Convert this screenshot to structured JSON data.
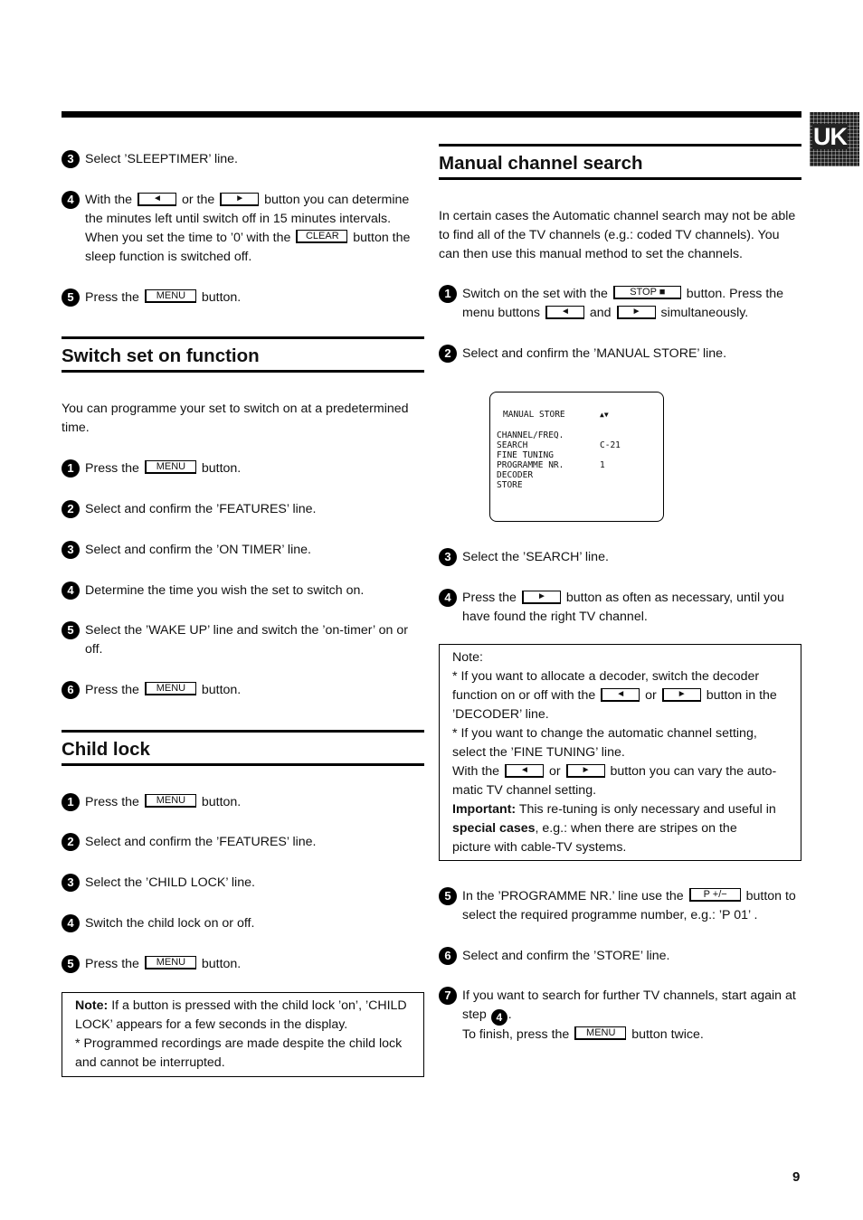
{
  "lang_tab": "UK",
  "page_number": "9",
  "left": {
    "sleep_steps": [
      {
        "num": "3",
        "text": "Select ’SLEEPTIMER’ line."
      },
      {
        "num": "4",
        "parts": [
          "With the",
          "or the",
          "button you can determine the minutes left until switch off in 15 minutes intervals. When you set the time to ’0’ with the",
          "button the sleep function is switched off."
        ]
      },
      {
        "num": "5",
        "parts": [
          "Press the",
          "button."
        ]
      }
    ],
    "switch_on": {
      "title": "Switch set on function",
      "intro": "You can programme your set to switch on at a predetermined time.",
      "steps": [
        {
          "num": "1",
          "parts": [
            "Press the",
            "button."
          ]
        },
        {
          "num": "2",
          "text": "Select and confirm the ’FEATURES’ line."
        },
        {
          "num": "3",
          "text": "Select and confirm the ’ON TIMER’ line."
        },
        {
          "num": "4",
          "text": "Determine the time you wish the set to switch on."
        },
        {
          "num": "5",
          "text": "Select the ’WAKE UP’ line and switch the ’on-timer’ on or off."
        },
        {
          "num": "6",
          "parts": [
            "Press the",
            "button."
          ]
        }
      ]
    },
    "child_lock": {
      "title": "Child lock",
      "steps": [
        {
          "num": "1",
          "parts": [
            "Press the",
            "button."
          ]
        },
        {
          "num": "2",
          "text": "Select and confirm the ’FEATURES’ line."
        },
        {
          "num": "3",
          "text": "Select the ’CHILD LOCK’ line."
        },
        {
          "num": "4",
          "text": "Switch the child lock on or off."
        },
        {
          "num": "5",
          "parts": [
            "Press the",
            "button."
          ]
        }
      ],
      "note_label": "Note:",
      "note_text": " If a button is pressed with the child lock ’on’, ’CHILD LOCK’ appears for a few seconds in the display.",
      "note_text2": "* Programmed recordings are made despite the child lock and cannot be interrupted."
    }
  },
  "right": {
    "manual": {
      "title": "Manual channel search",
      "intro": "In certain cases the Automatic channel search may not be able to find all of the TV channels (e.g.: coded TV channels). You can then use this manual method to set the channels.",
      "step1_parts": [
        "Switch on the set with the",
        "button. Press the menu buttons",
        "and",
        "simultaneously."
      ],
      "step2": "Select and confirm the ’MANUAL STORE’ line.",
      "osd": {
        "title": "MANUAL STORE",
        "arrows": "▲▼",
        "rows": [
          "CHANNEL/FREQ.",
          "SEARCH",
          "FINE TUNING",
          "PROGRAMME NR.",
          "DECODER",
          "STORE"
        ],
        "search_value": "C-21",
        "programme_value": "1"
      },
      "step3": "Select the ’SEARCH’ line.",
      "step4_parts": [
        "Press the",
        "button as often as necessary, until you have found the right TV channel."
      ],
      "note": {
        "label": "Note:",
        "l1": "* If you want to allocate a decoder, switch the decoder",
        "l2a": "function on or off with the",
        "l2b": "or",
        "l2c": "button in the",
        "l3": "’DECODER’ line.",
        "l4": "* If you want to change the automatic channel setting,",
        "l5": "select the ’FINE TUNING’ line.",
        "l6a": "With the",
        "l6b": "or",
        "l6c": "button you can vary the auto-",
        "l7": "matic TV channel setting.",
        "important_label": "Important:",
        "l8": " This re-tuning is only necessary and useful in",
        "special_label": "special cases",
        "l9": ", e.g.: when there are stripes on the",
        "l10": "picture with cable-TV systems."
      },
      "step5_parts": [
        "In the ’PROGRAMME NR.’ line use the",
        "button to select the required programme number, e.g.: ’P 01’ ."
      ],
      "step6": "Select and confirm the ’STORE’ line.",
      "step7_parts": [
        "If you want to search for further TV channels, start again at step",
        ".",
        "To finish, press the",
        "button twice."
      ],
      "step7_ref": "4"
    }
  },
  "keys": {
    "left": "◄",
    "right": "►",
    "clear": "CLEAR",
    "menu": "MENU",
    "stop": "STOP ■",
    "pplus": "P +/−"
  }
}
